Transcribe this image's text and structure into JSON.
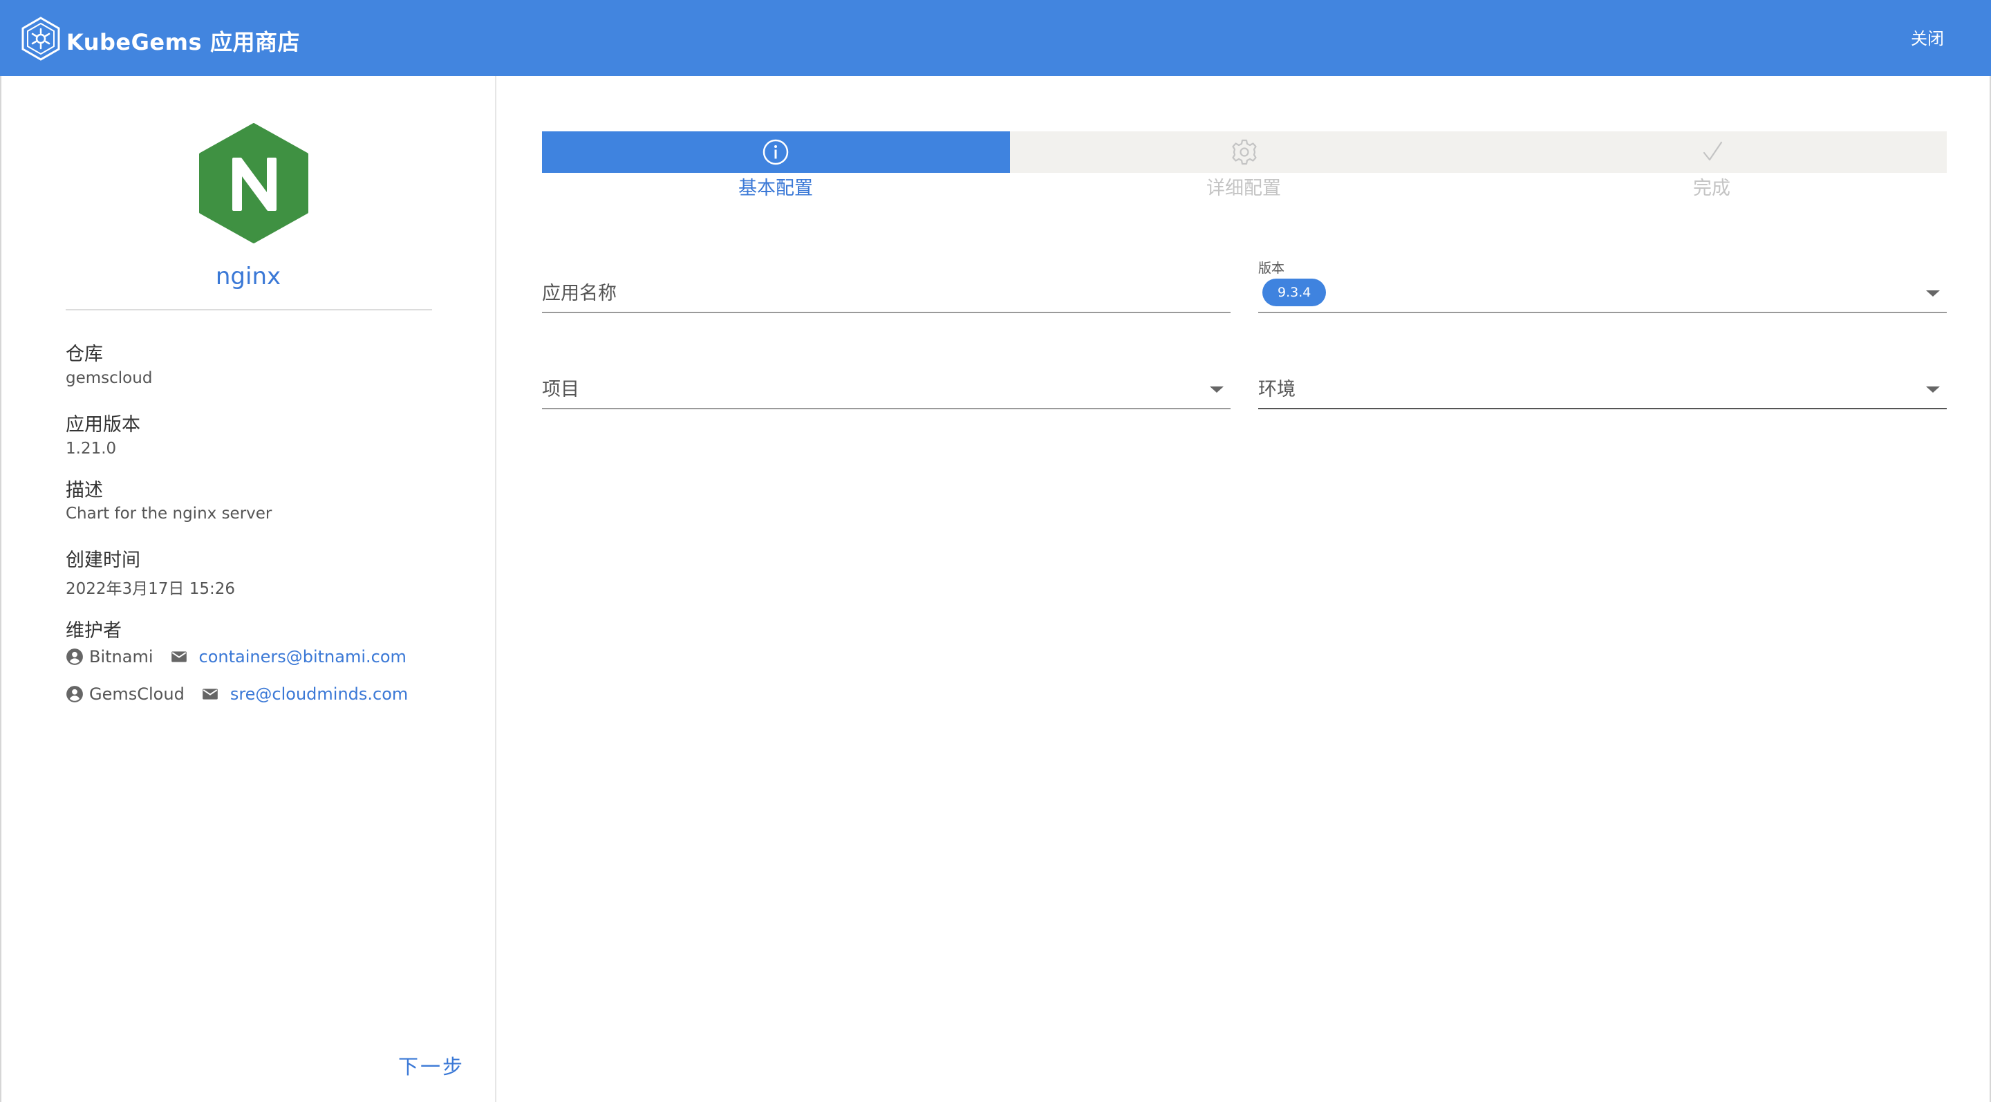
{
  "header": {
    "brand": "KubeGems",
    "subtitle": "应用商店",
    "close_label": "关闭",
    "color": "#4285df"
  },
  "app": {
    "name": "nginx",
    "logo_letter": "N",
    "logo_color": "#3f9142",
    "repository_label": "仓库",
    "repository": "gemscloud",
    "app_version_label": "应用版本",
    "app_version": "1.21.0",
    "description_label": "描述",
    "description": "Chart for the nginx server",
    "created_label": "创建时间",
    "created": "2022年3月17日 15:26",
    "maintainers_label": "维护者",
    "maintainers": [
      {
        "name": "Bitnami",
        "email": "containers@bitnami.com"
      },
      {
        "name": "GemsCloud",
        "email": "sre@cloudminds.com"
      }
    ],
    "next_label": "下一步"
  },
  "stepper": {
    "steps": [
      {
        "label": "基本配置",
        "icon": "info-icon",
        "state": "active"
      },
      {
        "label": "详细配置",
        "icon": "gear-icon",
        "state": "pending"
      },
      {
        "label": "完成",
        "icon": "check-icon",
        "state": "pending"
      }
    ],
    "active_color": "#3f83df",
    "inactive_color": "#c4c4c4"
  },
  "form": {
    "app_name_placeholder": "应用名称",
    "version_label": "版本",
    "version_value": "9.3.4",
    "project_placeholder": "项目",
    "environment_placeholder": "环境"
  }
}
